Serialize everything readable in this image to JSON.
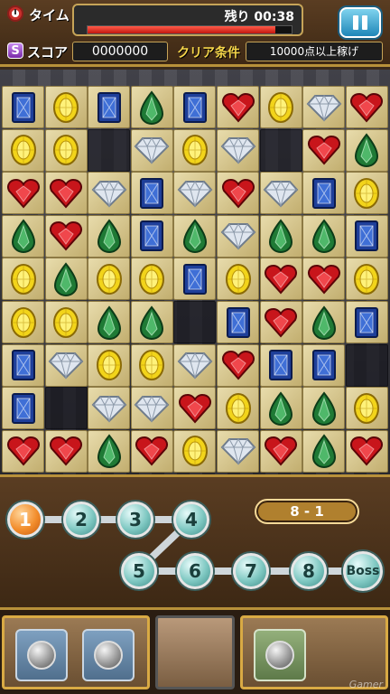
{
  "header": {
    "time_label": "タイム",
    "remaining": "残り 00:38",
    "timer_progress": 0.92,
    "score_label": "スコア",
    "score_icon_letter": "S",
    "score_value": "0000000",
    "clear_label": "クリア条件",
    "clear_condition": "10000点以上稼げ"
  },
  "board": {
    "rows": [
      [
        "sapphire",
        "topaz",
        "sapphire",
        "emerald",
        "sapphire",
        "ruby",
        "topaz",
        "diamond",
        "ruby"
      ],
      [
        "topaz",
        "topaz",
        "empty",
        "diamond",
        "topaz",
        "diamond",
        "empty",
        "ruby",
        "emerald"
      ],
      [
        "ruby",
        "ruby",
        "diamond",
        "sapphire",
        "diamond",
        "ruby",
        "diamond",
        "sapphire",
        "topaz"
      ],
      [
        "emerald",
        "ruby",
        "emerald",
        "sapphire",
        "emerald",
        "diamond",
        "emerald",
        "emerald",
        "sapphire"
      ],
      [
        "topaz",
        "emerald",
        "topaz",
        "topaz",
        "sapphire",
        "topaz",
        "ruby",
        "ruby",
        "topaz"
      ],
      [
        "topaz",
        "topaz",
        "emerald",
        "emerald",
        "empty",
        "sapphire",
        "ruby",
        "emerald",
        "sapphire"
      ],
      [
        "sapphire",
        "diamond",
        "topaz",
        "topaz",
        "diamond",
        "ruby",
        "sapphire",
        "sapphire",
        "empty"
      ],
      [
        "sapphire",
        "empty",
        "diamond",
        "diamond",
        "ruby",
        "topaz",
        "emerald",
        "emerald",
        "topaz"
      ],
      [
        "ruby",
        "ruby",
        "emerald",
        "ruby",
        "topaz",
        "diamond",
        "ruby",
        "emerald",
        "ruby"
      ]
    ],
    "gem_colors": {
      "sapphire": "#1e3f9a",
      "topaz": "#f2d41a",
      "emerald": "#1f7a35",
      "ruby": "#c8151b",
      "diamond": "#dfe6ef"
    }
  },
  "stage_map": {
    "current_stage": "8 - 1",
    "nodes": [
      "1",
      "2",
      "3",
      "4",
      "5",
      "6",
      "7",
      "8",
      "Boss"
    ],
    "active_node": "1"
  },
  "footer": {
    "watermark": "Gamer"
  }
}
